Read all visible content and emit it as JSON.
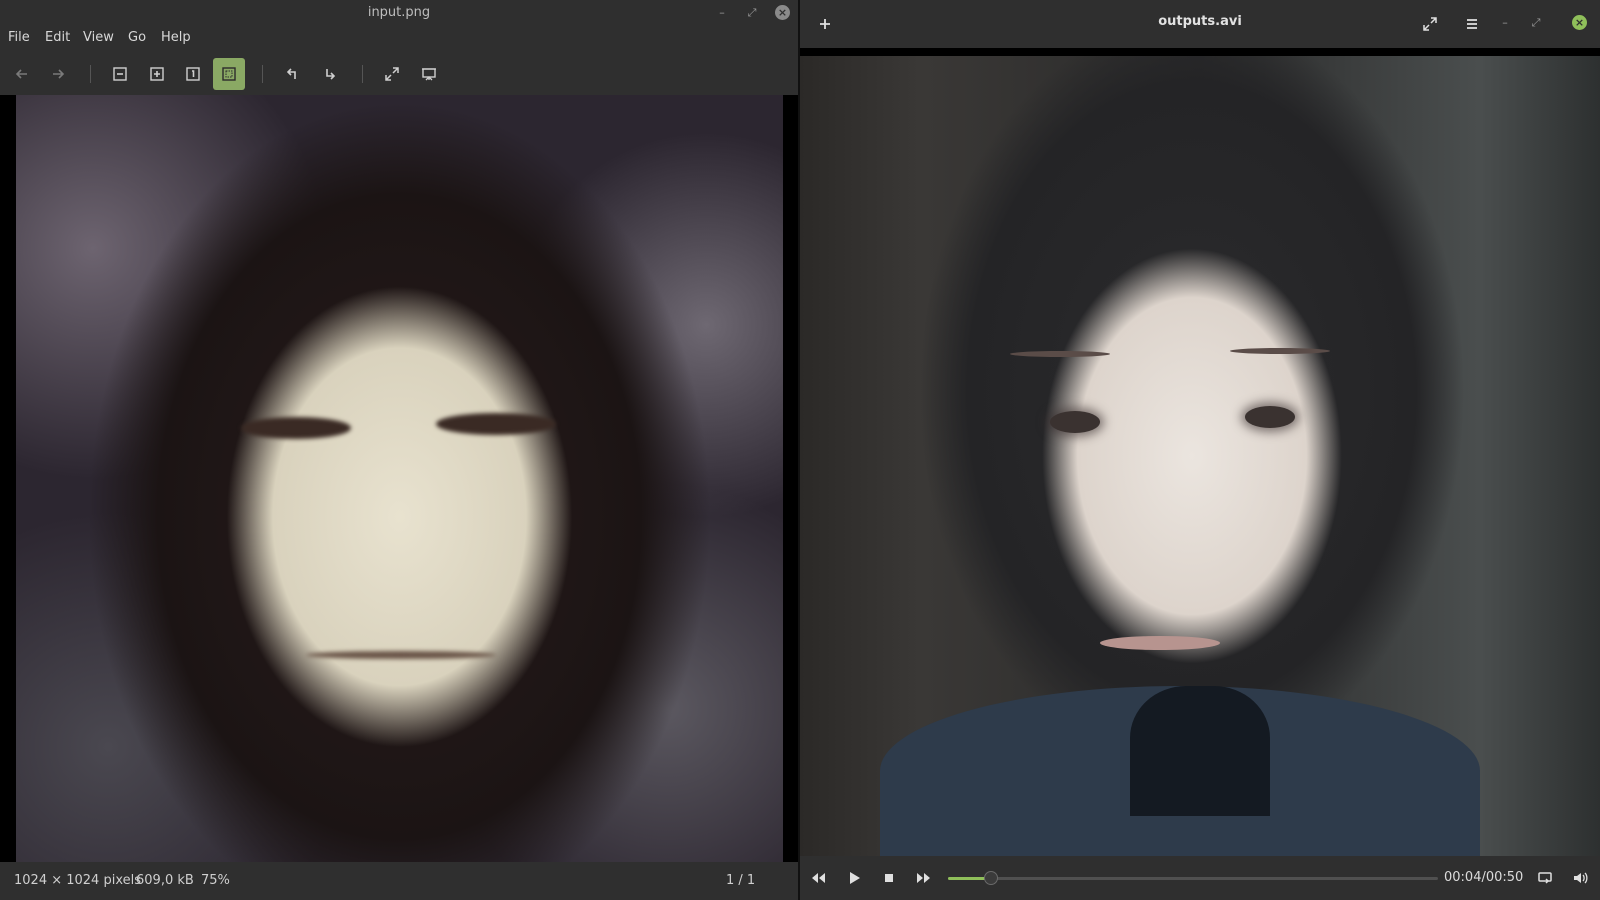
{
  "viewer": {
    "title": "input.png",
    "menu": [
      "File",
      "Edit",
      "View",
      "Go",
      "Help"
    ],
    "status": {
      "dimensions": "1024 × 1024 pixels",
      "size": "609,0 kB",
      "zoom": "75%",
      "page": "1 / 1"
    },
    "toolbar_icons": [
      "back-arrow-icon",
      "forward-arrow-icon",
      "zoom-out-icon",
      "zoom-in-icon",
      "zoom-normal-icon",
      "zoom-fit-icon",
      "rotate-left-icon",
      "rotate-right-icon",
      "fullscreen-icon",
      "slideshow-icon"
    ],
    "active_tool": "zoom-fit-icon"
  },
  "player": {
    "title": "outputs.avi",
    "time": "00:04/00:50",
    "progress": 0.088,
    "accent": "#8fbf5a"
  }
}
